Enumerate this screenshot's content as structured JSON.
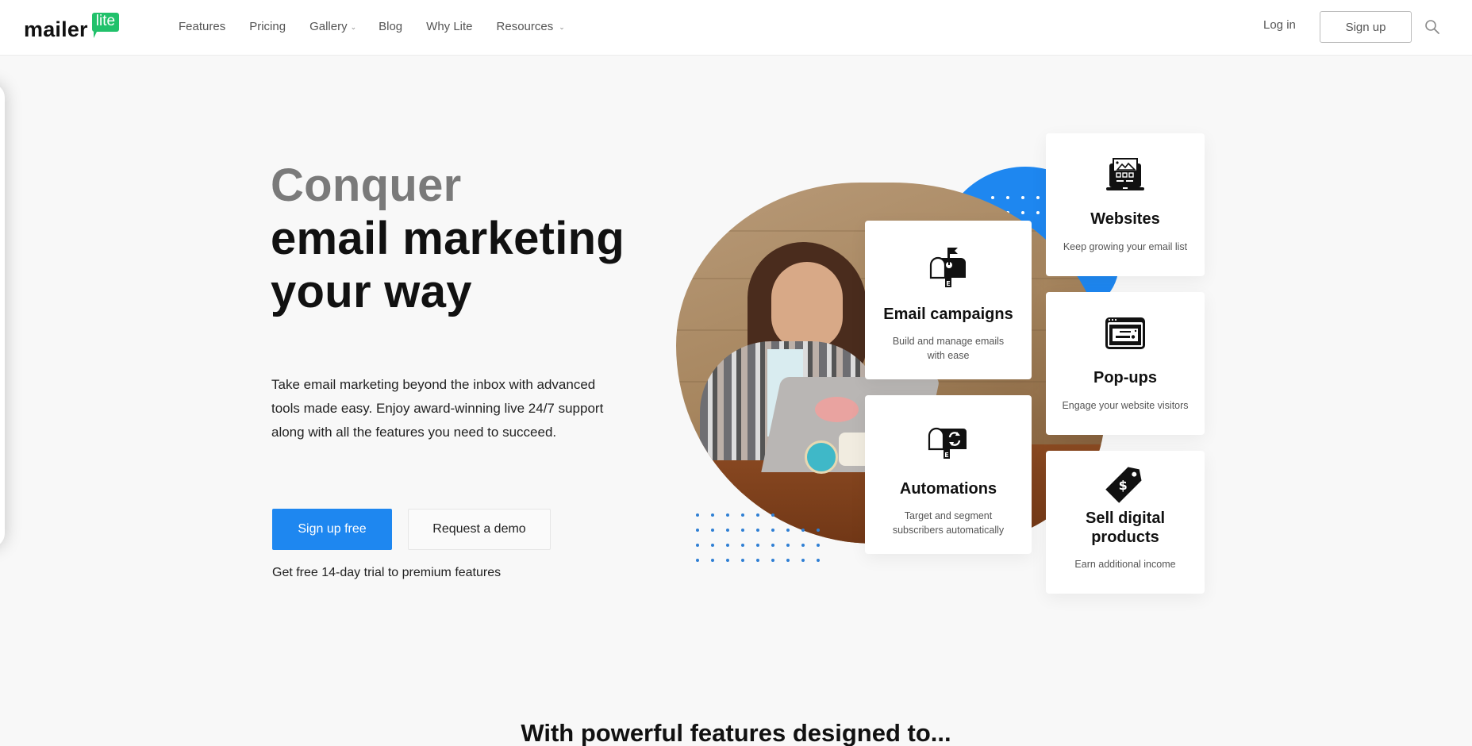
{
  "brand": {
    "logo_word": "mailer",
    "logo_badge": "lite",
    "accent_color": "#1e87f0",
    "logo_green": "#21c16b"
  },
  "nav": {
    "items": [
      {
        "label": "Features",
        "has_dropdown": false
      },
      {
        "label": "Pricing",
        "has_dropdown": false
      },
      {
        "label": "Gallery",
        "has_dropdown": true
      },
      {
        "label": "Blog",
        "has_dropdown": false
      },
      {
        "label": "Why Lite",
        "has_dropdown": false
      },
      {
        "label": "Resources",
        "has_dropdown": true
      }
    ],
    "dropdown_icon": "chevron-down-icon",
    "login_label": "Log in",
    "signup_label": "Sign up",
    "search_icon": "search-icon"
  },
  "hero": {
    "title_line1": "Conquer",
    "title_line2": "email marketing",
    "title_line3": "your way",
    "description": "Take email marketing beyond the inbox with advanced tools made easy. Enjoy award-winning live 24/7 support along with all the features you need to succeed.",
    "primary_cta": "Sign up free",
    "secondary_cta": "Request a demo",
    "trial_note": "Get free 14-day trial to premium features"
  },
  "features": [
    {
      "title": "Email campaigns",
      "description": "Build and manage emails with ease",
      "icon": "mailbox-flag-icon"
    },
    {
      "title": "Automations",
      "description": "Target and segment subscribers automatically",
      "icon": "mailbox-refresh-icon"
    },
    {
      "title": "Websites",
      "description": "Keep growing your email list",
      "icon": "website-laptop-icon"
    },
    {
      "title": "Pop-ups",
      "description": "Engage your website visitors",
      "icon": "popup-window-icon"
    },
    {
      "title": "Sell digital products",
      "description": "Earn additional income",
      "icon": "price-tag-icon"
    }
  ],
  "section": {
    "heading": "With powerful features designed to..."
  }
}
